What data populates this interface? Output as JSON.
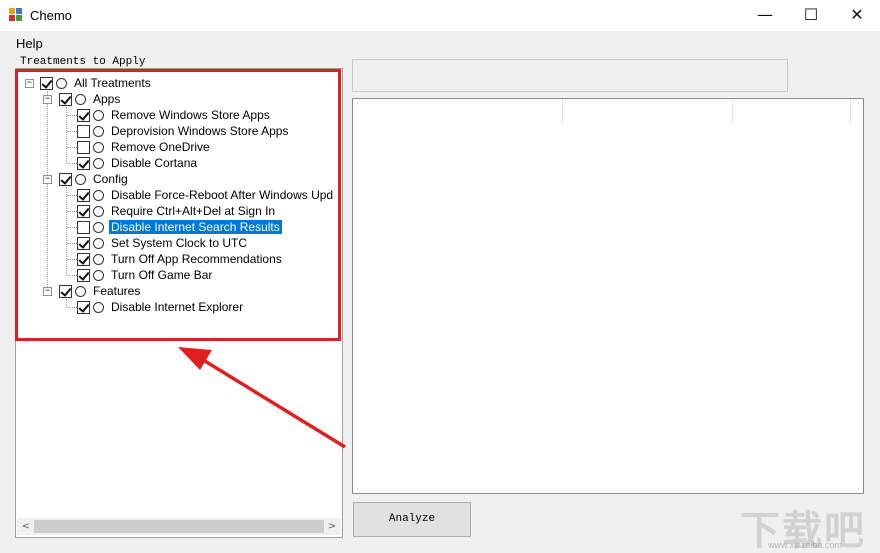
{
  "window": {
    "title": "Chemo",
    "minimize": "—",
    "maximize": "☐",
    "close": "✕"
  },
  "menu": {
    "help": "Help"
  },
  "treatments": {
    "group_label": "Treatments to Apply",
    "root": {
      "label": "All Treatments",
      "checked": true
    },
    "apps": {
      "label": "Apps",
      "checked": true,
      "items": [
        {
          "label": "Remove Windows Store Apps",
          "checked": true
        },
        {
          "label": "Deprovision Windows Store Apps",
          "checked": false
        },
        {
          "label": "Remove OneDrive",
          "checked": false
        },
        {
          "label": "Disable Cortana",
          "checked": true
        }
      ]
    },
    "config": {
      "label": "Config",
      "checked": true,
      "items": [
        {
          "label": "Disable Force-Reboot After Windows Upd",
          "checked": true
        },
        {
          "label": "Require Ctrl+Alt+Del at Sign In",
          "checked": true
        },
        {
          "label": "Disable Internet Search Results",
          "checked": false,
          "selected": true
        },
        {
          "label": "Set System Clock to UTC",
          "checked": true
        },
        {
          "label": "Turn Off App Recommendations",
          "checked": true
        },
        {
          "label": "Turn Off Game Bar",
          "checked": true
        }
      ]
    },
    "features": {
      "label": "Features",
      "checked": true,
      "items": [
        {
          "label": "Disable Internet Explorer",
          "checked": true
        }
      ]
    }
  },
  "scrollbar": {
    "left_arrow": "<",
    "right_arrow": ">"
  },
  "analyze_button": {
    "label": "Analyze"
  },
  "colors": {
    "annotation": "#e02020",
    "selection": "#0078d7"
  },
  "watermark": {
    "text": "下载吧",
    "url": "www.xiazaiba.com"
  }
}
